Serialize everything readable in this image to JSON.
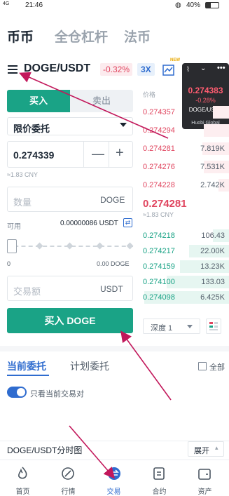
{
  "status": {
    "time": "21:46",
    "battery": "40%",
    "signal": "4G"
  },
  "topnav": {
    "tabs": [
      "币币",
      "全仓杠杆",
      "法币"
    ]
  },
  "pair": {
    "symbol": "DOGE/USDT",
    "change": "-0.32%",
    "leverage": "3X",
    "new_badge": "NEW"
  },
  "tick_card": {
    "price": "0.274383",
    "change": "-0.28%",
    "pair": "DOGE/USDT",
    "brand": "Huobi Global"
  },
  "order_form": {
    "buy_tab": "买入",
    "sell_tab": "卖出",
    "order_type": "限价委托",
    "price_value": "0.274339",
    "price_cny": "≈1.83 CNY",
    "amount_placeholder": "数量",
    "amount_unit": "DOGE",
    "available_label": "可用",
    "available_value": "0.00000086 USDT",
    "slider_min": "0",
    "slider_max": "0.00 DOGE",
    "slider_fraction": 0,
    "total_placeholder": "交易额",
    "total_unit": "USDT",
    "submit": "买入 DOGE"
  },
  "orderbook": {
    "header_price": "价格",
    "asks": [
      {
        "price": "0.274357",
        "amount": "",
        "depth": 0.18
      },
      {
        "price": "0.274294",
        "amount": "",
        "depth": 0.28
      },
      {
        "price": "0.274281",
        "amount": "7.819K",
        "depth": 0.3
      },
      {
        "price": "0.274276",
        "amount": "7.531K",
        "depth": 0.28
      },
      {
        "price": "0.274228",
        "amount": "2.742K",
        "depth": 0.12
      }
    ],
    "mid_price": "0.274281",
    "mid_cny": "≈1.83 CNY",
    "bids": [
      {
        "price": "0.274218",
        "amount": "106.43",
        "depth": 0.18
      },
      {
        "price": "0.274217",
        "amount": "22.00K",
        "depth": 0.45
      },
      {
        "price": "0.274159",
        "amount": "13.23K",
        "depth": 0.55
      },
      {
        "price": "0.274100",
        "amount": "133.03",
        "depth": 0.7
      },
      {
        "price": "0.274098",
        "amount": "6.425K",
        "depth": 0.95
      }
    ],
    "depth_label": "深度 1"
  },
  "orders": {
    "tab_current": "当前委托",
    "tab_plan": "计划委托",
    "all": "全部",
    "toggle_label": "只看当前交易对"
  },
  "chart_section": {
    "title": "DOGE/USDT分时图",
    "expand": "展开"
  },
  "bottomnav": {
    "items": [
      "首页",
      "行情",
      "交易",
      "合约",
      "资产"
    ]
  },
  "colors": {
    "green": "#1aa386",
    "red": "#e0455f",
    "arrow": "#c2185b"
  }
}
